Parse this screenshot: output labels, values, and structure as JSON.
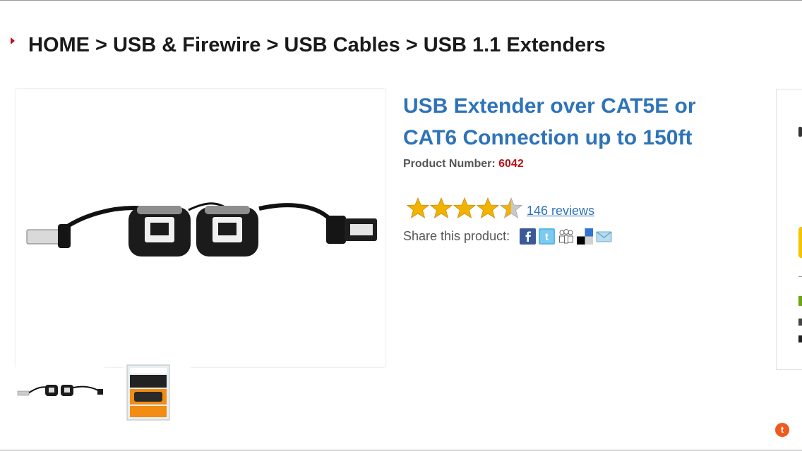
{
  "breadcrumb": {
    "items": [
      "HOME",
      "USB & Firewire",
      "USB Cables",
      "USB 1.1 Extenders"
    ],
    "separator": ">"
  },
  "product": {
    "title": "USB Extender over CAT5E or CAT6 Connection up to 150ft",
    "number_label": "Product Number:",
    "number": "6042",
    "rating": {
      "value": 4.5,
      "max": 5
    },
    "reviews_link": "146 reviews",
    "share_label": "Share this product:",
    "share_icons": [
      "facebook-icon",
      "twitter-icon",
      "myspace-icon",
      "delicious-icon",
      "email-icon"
    ]
  },
  "badge": {
    "letter": "t"
  },
  "colors": {
    "title_blue": "#2e73b8",
    "accent_red": "#b5121b",
    "star_gold": "#f3b200"
  }
}
